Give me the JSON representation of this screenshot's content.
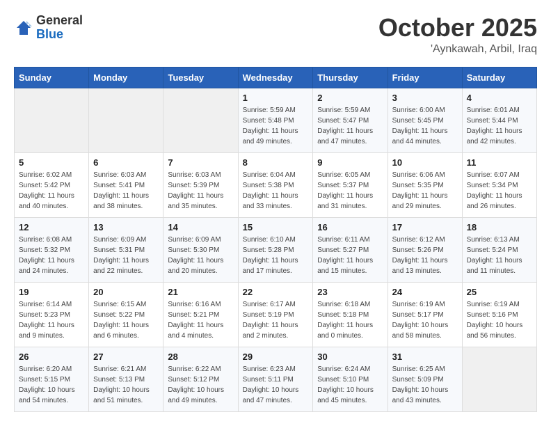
{
  "logo": {
    "general": "General",
    "blue": "Blue"
  },
  "header": {
    "month": "October 2025",
    "location": "'Aynkawah, Arbil, Iraq"
  },
  "weekdays": [
    "Sunday",
    "Monday",
    "Tuesday",
    "Wednesday",
    "Thursday",
    "Friday",
    "Saturday"
  ],
  "weeks": [
    [
      {
        "day": "",
        "sunrise": "",
        "sunset": "",
        "daylight": ""
      },
      {
        "day": "",
        "sunrise": "",
        "sunset": "",
        "daylight": ""
      },
      {
        "day": "",
        "sunrise": "",
        "sunset": "",
        "daylight": ""
      },
      {
        "day": "1",
        "sunrise": "Sunrise: 5:59 AM",
        "sunset": "Sunset: 5:48 PM",
        "daylight": "Daylight: 11 hours and 49 minutes."
      },
      {
        "day": "2",
        "sunrise": "Sunrise: 5:59 AM",
        "sunset": "Sunset: 5:47 PM",
        "daylight": "Daylight: 11 hours and 47 minutes."
      },
      {
        "day": "3",
        "sunrise": "Sunrise: 6:00 AM",
        "sunset": "Sunset: 5:45 PM",
        "daylight": "Daylight: 11 hours and 44 minutes."
      },
      {
        "day": "4",
        "sunrise": "Sunrise: 6:01 AM",
        "sunset": "Sunset: 5:44 PM",
        "daylight": "Daylight: 11 hours and 42 minutes."
      }
    ],
    [
      {
        "day": "5",
        "sunrise": "Sunrise: 6:02 AM",
        "sunset": "Sunset: 5:42 PM",
        "daylight": "Daylight: 11 hours and 40 minutes."
      },
      {
        "day": "6",
        "sunrise": "Sunrise: 6:03 AM",
        "sunset": "Sunset: 5:41 PM",
        "daylight": "Daylight: 11 hours and 38 minutes."
      },
      {
        "day": "7",
        "sunrise": "Sunrise: 6:03 AM",
        "sunset": "Sunset: 5:39 PM",
        "daylight": "Daylight: 11 hours and 35 minutes."
      },
      {
        "day": "8",
        "sunrise": "Sunrise: 6:04 AM",
        "sunset": "Sunset: 5:38 PM",
        "daylight": "Daylight: 11 hours and 33 minutes."
      },
      {
        "day": "9",
        "sunrise": "Sunrise: 6:05 AM",
        "sunset": "Sunset: 5:37 PM",
        "daylight": "Daylight: 11 hours and 31 minutes."
      },
      {
        "day": "10",
        "sunrise": "Sunrise: 6:06 AM",
        "sunset": "Sunset: 5:35 PM",
        "daylight": "Daylight: 11 hours and 29 minutes."
      },
      {
        "day": "11",
        "sunrise": "Sunrise: 6:07 AM",
        "sunset": "Sunset: 5:34 PM",
        "daylight": "Daylight: 11 hours and 26 minutes."
      }
    ],
    [
      {
        "day": "12",
        "sunrise": "Sunrise: 6:08 AM",
        "sunset": "Sunset: 5:32 PM",
        "daylight": "Daylight: 11 hours and 24 minutes."
      },
      {
        "day": "13",
        "sunrise": "Sunrise: 6:09 AM",
        "sunset": "Sunset: 5:31 PM",
        "daylight": "Daylight: 11 hours and 22 minutes."
      },
      {
        "day": "14",
        "sunrise": "Sunrise: 6:09 AM",
        "sunset": "Sunset: 5:30 PM",
        "daylight": "Daylight: 11 hours and 20 minutes."
      },
      {
        "day": "15",
        "sunrise": "Sunrise: 6:10 AM",
        "sunset": "Sunset: 5:28 PM",
        "daylight": "Daylight: 11 hours and 17 minutes."
      },
      {
        "day": "16",
        "sunrise": "Sunrise: 6:11 AM",
        "sunset": "Sunset: 5:27 PM",
        "daylight": "Daylight: 11 hours and 15 minutes."
      },
      {
        "day": "17",
        "sunrise": "Sunrise: 6:12 AM",
        "sunset": "Sunset: 5:26 PM",
        "daylight": "Daylight: 11 hours and 13 minutes."
      },
      {
        "day": "18",
        "sunrise": "Sunrise: 6:13 AM",
        "sunset": "Sunset: 5:24 PM",
        "daylight": "Daylight: 11 hours and 11 minutes."
      }
    ],
    [
      {
        "day": "19",
        "sunrise": "Sunrise: 6:14 AM",
        "sunset": "Sunset: 5:23 PM",
        "daylight": "Daylight: 11 hours and 9 minutes."
      },
      {
        "day": "20",
        "sunrise": "Sunrise: 6:15 AM",
        "sunset": "Sunset: 5:22 PM",
        "daylight": "Daylight: 11 hours and 6 minutes."
      },
      {
        "day": "21",
        "sunrise": "Sunrise: 6:16 AM",
        "sunset": "Sunset: 5:21 PM",
        "daylight": "Daylight: 11 hours and 4 minutes."
      },
      {
        "day": "22",
        "sunrise": "Sunrise: 6:17 AM",
        "sunset": "Sunset: 5:19 PM",
        "daylight": "Daylight: 11 hours and 2 minutes."
      },
      {
        "day": "23",
        "sunrise": "Sunrise: 6:18 AM",
        "sunset": "Sunset: 5:18 PM",
        "daylight": "Daylight: 11 hours and 0 minutes."
      },
      {
        "day": "24",
        "sunrise": "Sunrise: 6:19 AM",
        "sunset": "Sunset: 5:17 PM",
        "daylight": "Daylight: 10 hours and 58 minutes."
      },
      {
        "day": "25",
        "sunrise": "Sunrise: 6:19 AM",
        "sunset": "Sunset: 5:16 PM",
        "daylight": "Daylight: 10 hours and 56 minutes."
      }
    ],
    [
      {
        "day": "26",
        "sunrise": "Sunrise: 6:20 AM",
        "sunset": "Sunset: 5:15 PM",
        "daylight": "Daylight: 10 hours and 54 minutes."
      },
      {
        "day": "27",
        "sunrise": "Sunrise: 6:21 AM",
        "sunset": "Sunset: 5:13 PM",
        "daylight": "Daylight: 10 hours and 51 minutes."
      },
      {
        "day": "28",
        "sunrise": "Sunrise: 6:22 AM",
        "sunset": "Sunset: 5:12 PM",
        "daylight": "Daylight: 10 hours and 49 minutes."
      },
      {
        "day": "29",
        "sunrise": "Sunrise: 6:23 AM",
        "sunset": "Sunset: 5:11 PM",
        "daylight": "Daylight: 10 hours and 47 minutes."
      },
      {
        "day": "30",
        "sunrise": "Sunrise: 6:24 AM",
        "sunset": "Sunset: 5:10 PM",
        "daylight": "Daylight: 10 hours and 45 minutes."
      },
      {
        "day": "31",
        "sunrise": "Sunrise: 6:25 AM",
        "sunset": "Sunset: 5:09 PM",
        "daylight": "Daylight: 10 hours and 43 minutes."
      },
      {
        "day": "",
        "sunrise": "",
        "sunset": "",
        "daylight": ""
      }
    ]
  ]
}
